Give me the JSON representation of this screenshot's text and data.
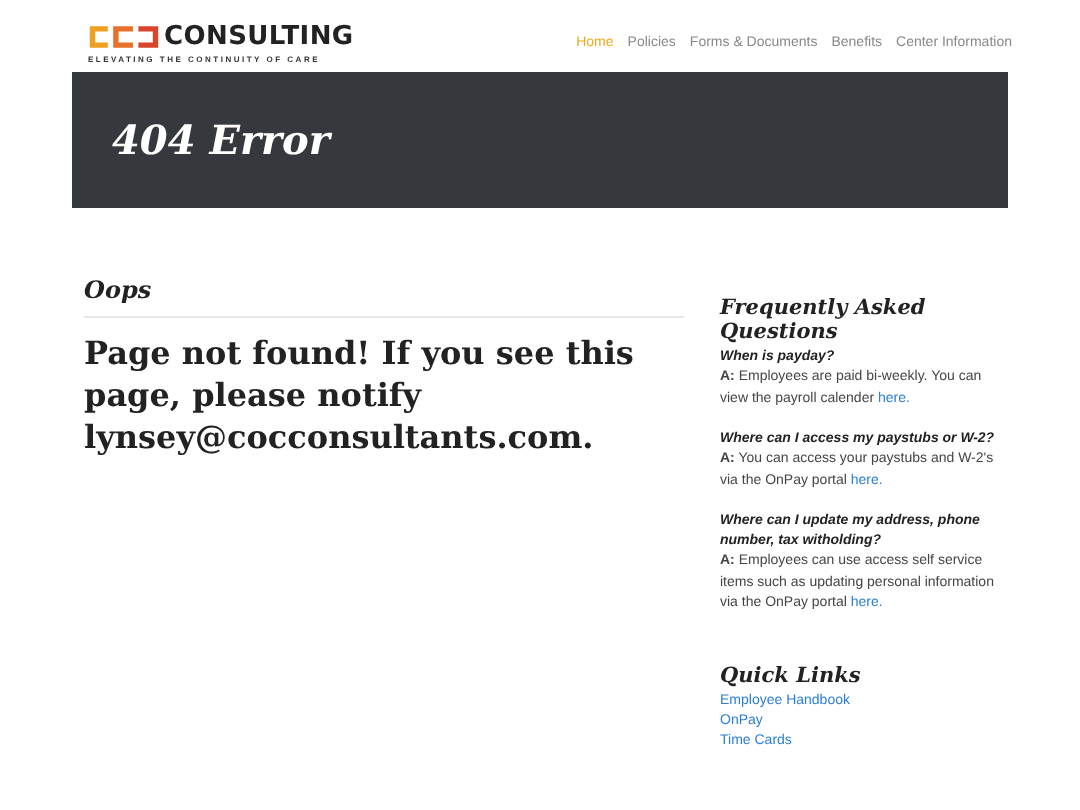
{
  "logo": {
    "name": "CONSULTING",
    "tagline": "ELEVATING THE CONTINUITY OF CARE"
  },
  "nav": [
    {
      "label": "Home",
      "selected": true
    },
    {
      "label": "Policies",
      "selected": false
    },
    {
      "label": "Forms & Documents",
      "selected": false
    },
    {
      "label": "Benefits",
      "selected": false
    },
    {
      "label": "Center Information",
      "selected": false
    }
  ],
  "banner": {
    "title": "404 Error"
  },
  "main": {
    "subtitle": "Oops",
    "message": "Page not found! If you see this page, please notify lynsey@cocconsultants.com."
  },
  "faq": {
    "title": "Frequently Asked Questions",
    "items": [
      {
        "question": "When is payday?",
        "answer": "**A:** Employees are paid bi-weekly. You can view the payroll calender",
        "link": "here."
      },
      {
        "question": "Where can I access my paystubs or W-2?",
        "answer": "**A:** You can access your paystubs and W-2's via the OnPay portal",
        "link": "here."
      },
      {
        "question": "Where can I update my address, phone number, tax witholding?",
        "answer": "**A:** Employees can use access self service items such as updating personal information via the OnPay portal",
        "link": "here."
      }
    ]
  },
  "quick_links": {
    "title": "Quick Links",
    "links": [
      "Employee Handbook",
      "OnPay",
      "Time Cards"
    ]
  }
}
